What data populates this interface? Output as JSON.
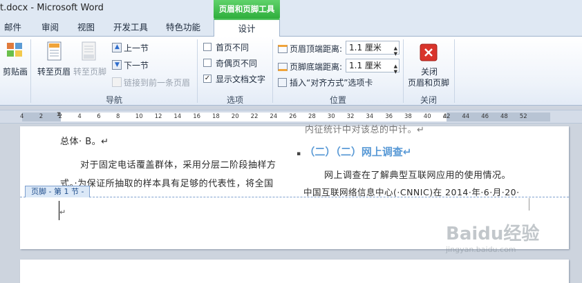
{
  "window": {
    "title": "t.docx - Microsoft Word",
    "context_group": "页眉和页脚工具"
  },
  "tabs": [
    "邮件",
    "审阅",
    "视图",
    "开发工具",
    "特色功能",
    "设计"
  ],
  "ribbon": {
    "clipboard": {
      "paste": "剪贴画"
    },
    "navigation": {
      "label": "导航",
      "goto_header": "转至页眉",
      "goto_footer": "转至页脚",
      "prev": "上一节",
      "next": "下一节",
      "link_prev": "链接到前一条页眉"
    },
    "options": {
      "label": "选项",
      "items": [
        {
          "label": "首页不同",
          "checked": false
        },
        {
          "label": "奇偶页不同",
          "checked": false
        },
        {
          "label": "显示文档文字",
          "checked": true
        }
      ]
    },
    "position": {
      "label": "位置",
      "header_dist_label": "页眉顶端距离:",
      "header_dist_value": "1.1 厘米",
      "footer_dist_label": "页脚底端距离:",
      "footer_dist_value": "1.1 厘米",
      "insert_align": "插入“对齐方式”选项卡"
    },
    "close": {
      "label": "关闭",
      "button_line1": "关闭",
      "button_line2": "页眉和页脚"
    }
  },
  "ruler": {
    "numbers": [
      "4",
      "2",
      "2",
      "4",
      "6",
      "8",
      "10",
      "12",
      "14",
      "16",
      "18",
      "20",
      "22",
      "24",
      "26",
      "28",
      "30",
      "32",
      "34",
      "36",
      "38",
      "40",
      "42",
      "44",
      "46",
      "48",
      "52"
    ]
  },
  "document": {
    "left_col": [
      "总体· B。↵",
      "对于固定电话覆盖群体，采用分层二阶段抽样方",
      "式。·为保证所抽取的样本具有足够的代表性，将全国"
    ],
    "right_top": "内征统计中对该总的中计。↵",
    "heading": "（二）（二）网上调查↵",
    "right_col": [
      "网上调查在了解典型互联网应用的使用情况。",
      "中国互联网络信息中心(·CNNIC)在 2014·年·6·月·20·"
    ],
    "footer_tag": "页脚 - 第 1 节 -",
    "footer_mark": "↵"
  },
  "watermark": {
    "text": "Baidu经验",
    "sub": "jingyan.baidu.com"
  }
}
